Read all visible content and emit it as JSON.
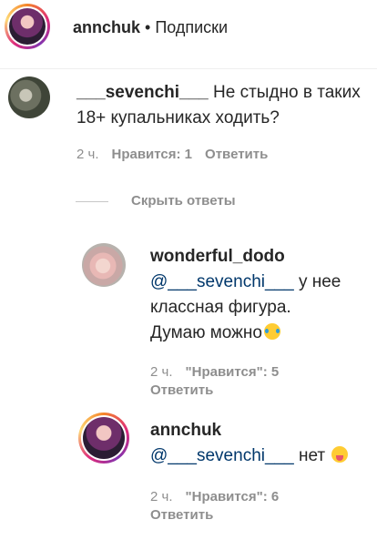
{
  "header": {
    "username": "annchuk",
    "separator": " • ",
    "subtitle": "Подписки"
  },
  "comment": {
    "username": "___sevenchi___",
    "text": " Не стыдно в таких 18+ купальниках ходить?",
    "time": "2 ч.",
    "likes": "Нравится: 1",
    "reply_label": "Ответить"
  },
  "hide_replies_label": "Скрыть ответы",
  "replies": [
    {
      "username": "wonderful_dodo",
      "mention": "@___sevenchi___",
      "text_line1": " у нее",
      "text_line2": "классная фигура.",
      "text_line3": "Думаю можно",
      "emoji": "laughing-emoji",
      "time": "2 ч.",
      "likes": "\"Нравится\": 5",
      "reply_label": "Ответить"
    },
    {
      "username": "annchuk",
      "mention": "@___sevenchi___",
      "text": " нет",
      "emoji": "tongue-out-emoji",
      "time": "2 ч.",
      "likes": "\"Нравится\": 6",
      "reply_label": "Ответить"
    }
  ],
  "colors": {
    "text": "#262626",
    "secondary": "#8e8e8e",
    "mention": "#00376b",
    "divider": "#efefef"
  }
}
